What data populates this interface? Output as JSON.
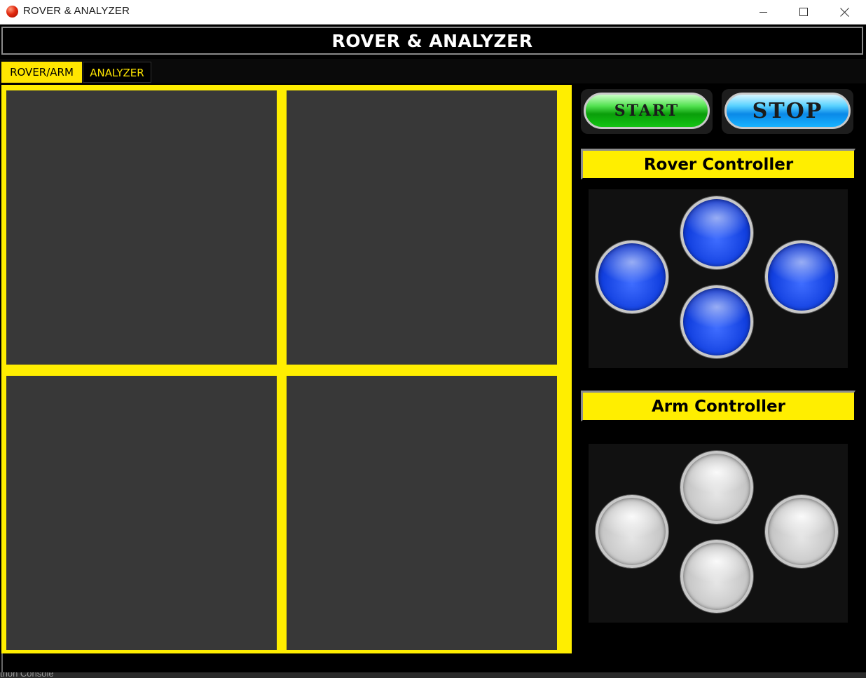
{
  "window": {
    "title": "ROVER & ANALYZER",
    "controls": {
      "minimize": "minimize",
      "maximize": "maximize",
      "close": "close"
    }
  },
  "header": {
    "title": "ROVER & ANALYZER"
  },
  "tabs": [
    {
      "label": "ROVER/ARM",
      "active": true
    },
    {
      "label": "ANALYZER",
      "active": false
    }
  ],
  "controls": {
    "start_label": "START",
    "stop_label": "STOP"
  },
  "rover_controller": {
    "title": "Rover Controller",
    "buttons": [
      "up",
      "left",
      "right",
      "down"
    ]
  },
  "arm_controller": {
    "title": "Arm Controller",
    "buttons": [
      "up",
      "left",
      "right",
      "down"
    ]
  },
  "console": {
    "label": "thon Console"
  },
  "colors": {
    "accent": "#ffee00",
    "background": "#000000",
    "panel": "#383838",
    "start": "#1ab81a",
    "stop": "#1aa8ff",
    "rover_pad": "#1240e0",
    "arm_pad": "#c4c4c4"
  }
}
